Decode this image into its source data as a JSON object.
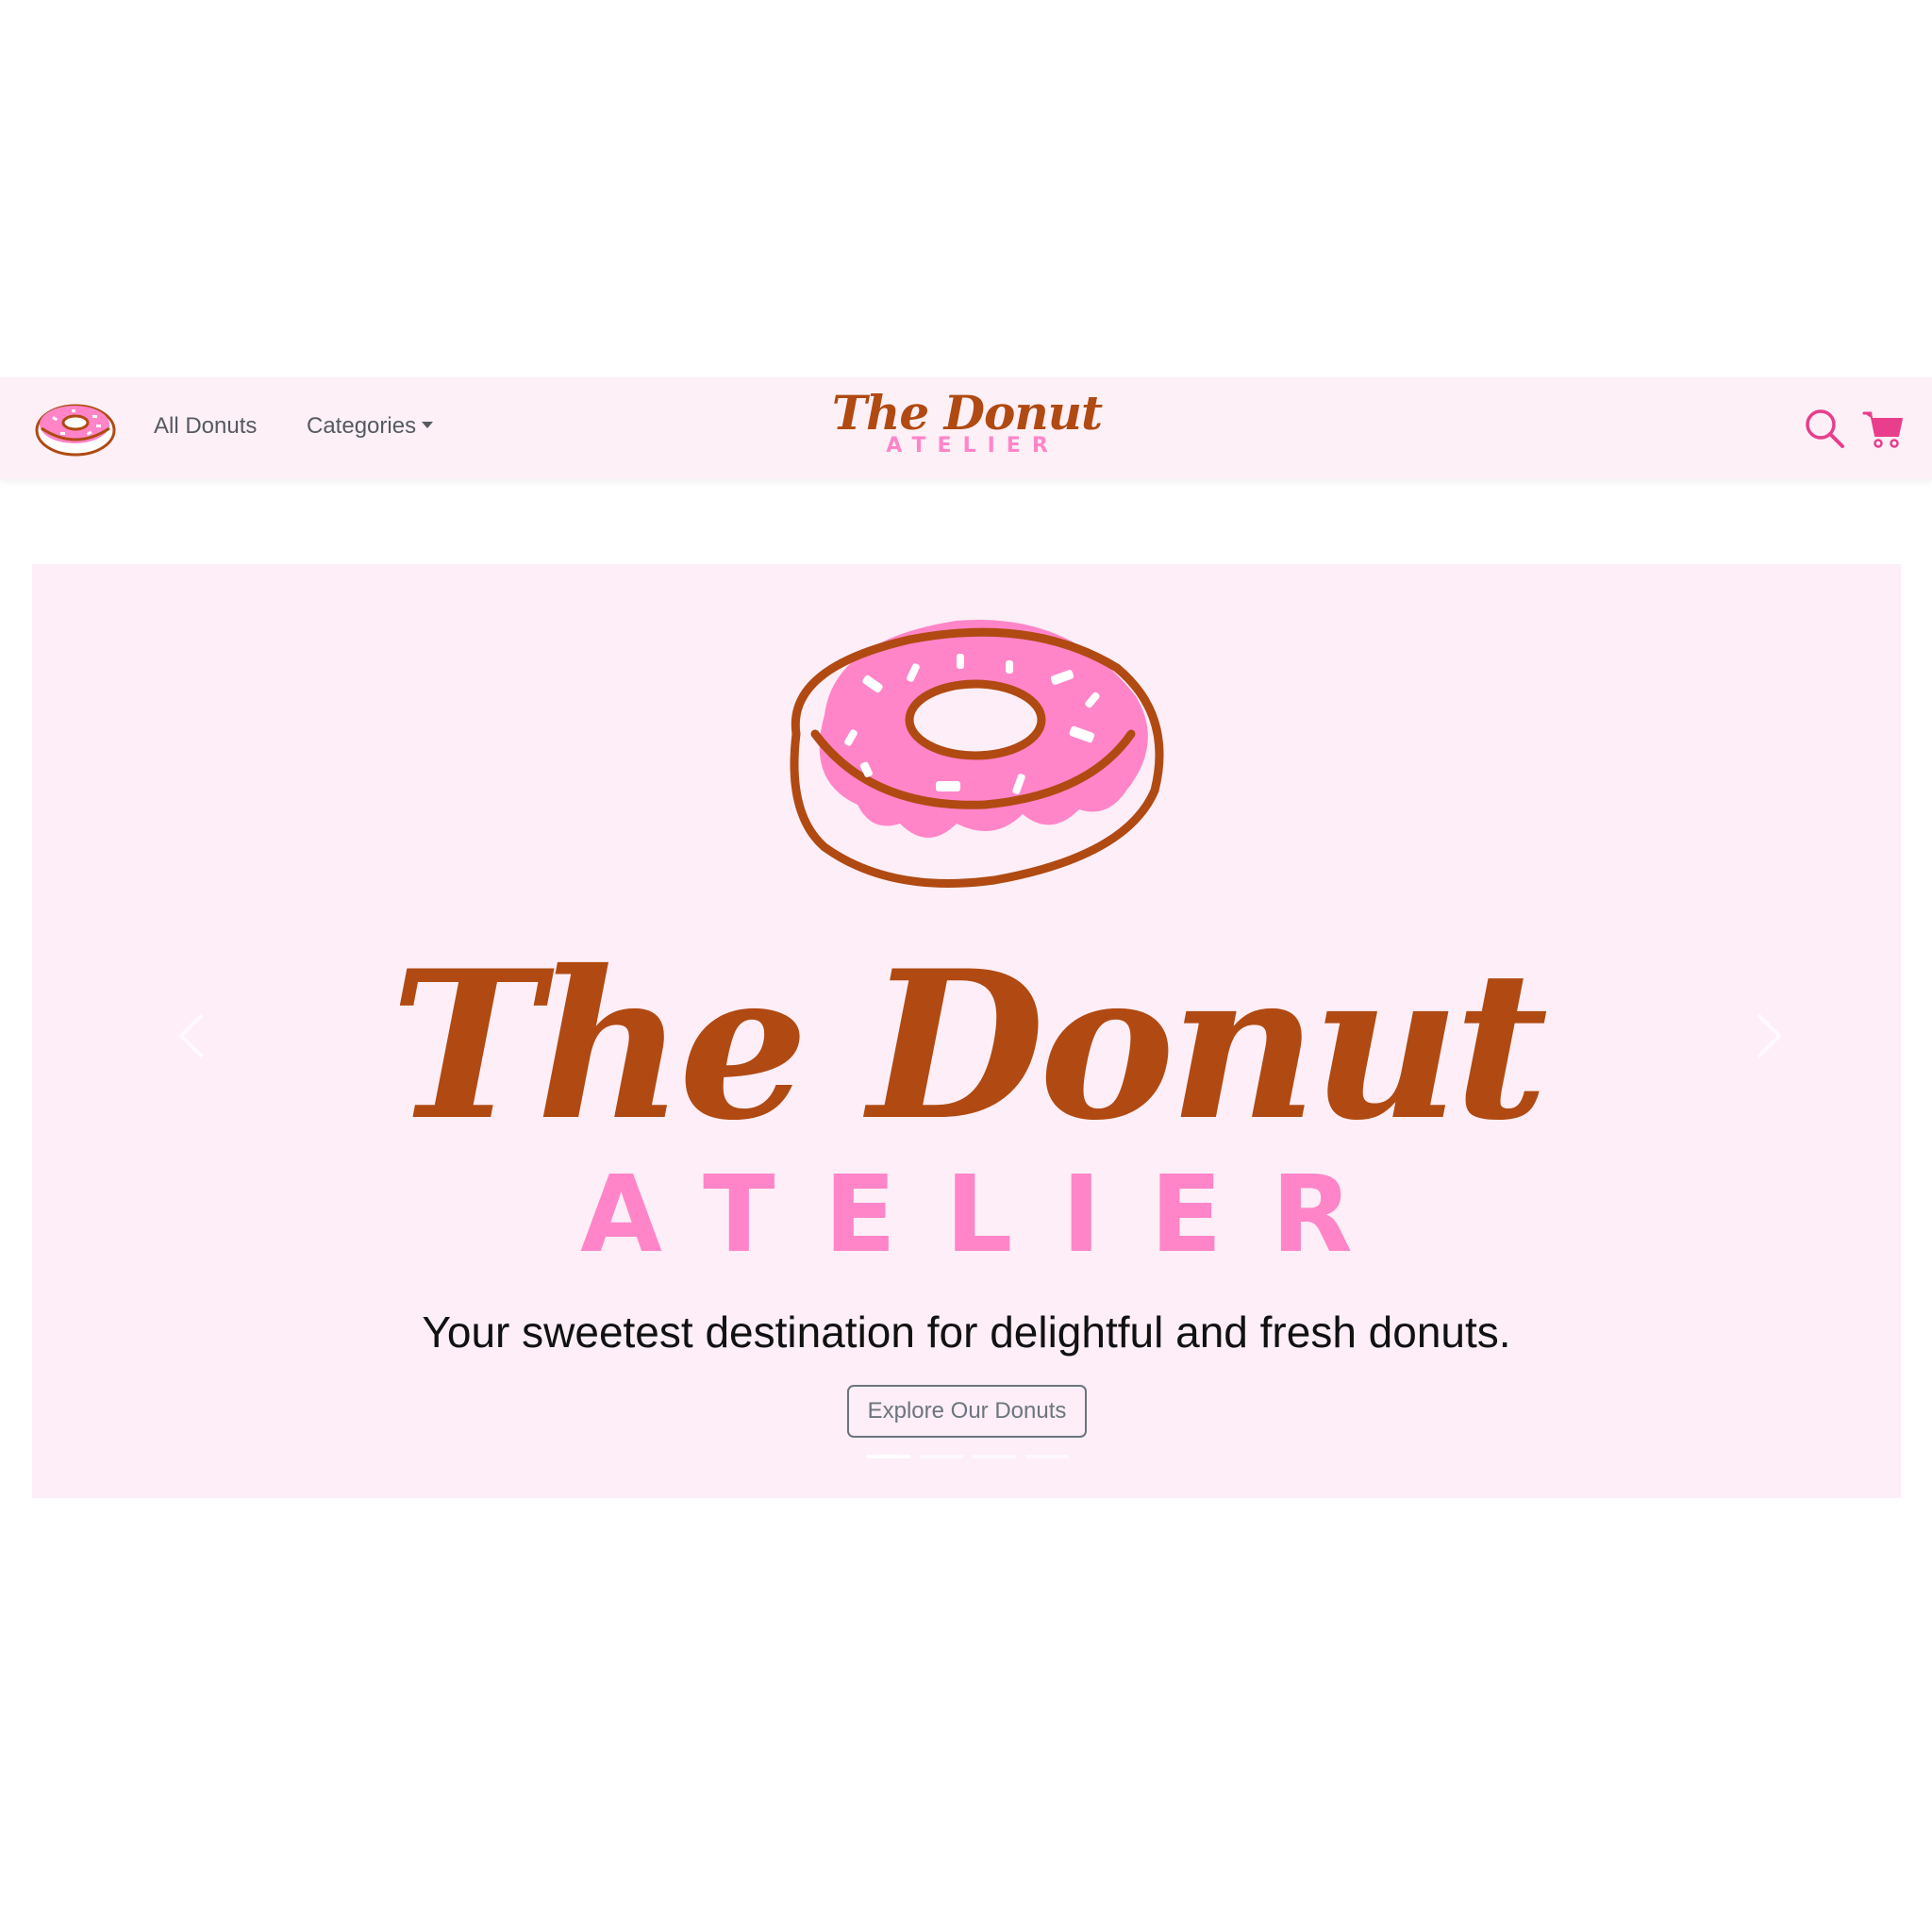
{
  "navbar": {
    "logo_icon": "donut-logo-icon",
    "links": [
      {
        "label": "All Donuts"
      },
      {
        "label": "Categories"
      }
    ],
    "brand": {
      "script": "The Donut",
      "sub": "ATELIER"
    },
    "icons": [
      "search-icon",
      "cart-icon"
    ]
  },
  "hero": {
    "title": "The Donut",
    "subtitle": "ATELIER",
    "tagline": "Your sweetest destination for delightful and fresh donuts.",
    "cta_label": "Explore Our Donuts",
    "slide_count": 4,
    "active_slide": 0
  },
  "colors": {
    "brand_brown": "#b04a12",
    "brand_pink": "#ff85c8",
    "navbar_bg": "#fdf0f7",
    "hero_bg": "#fdeef7",
    "accent_pink": "#e83e8c"
  }
}
